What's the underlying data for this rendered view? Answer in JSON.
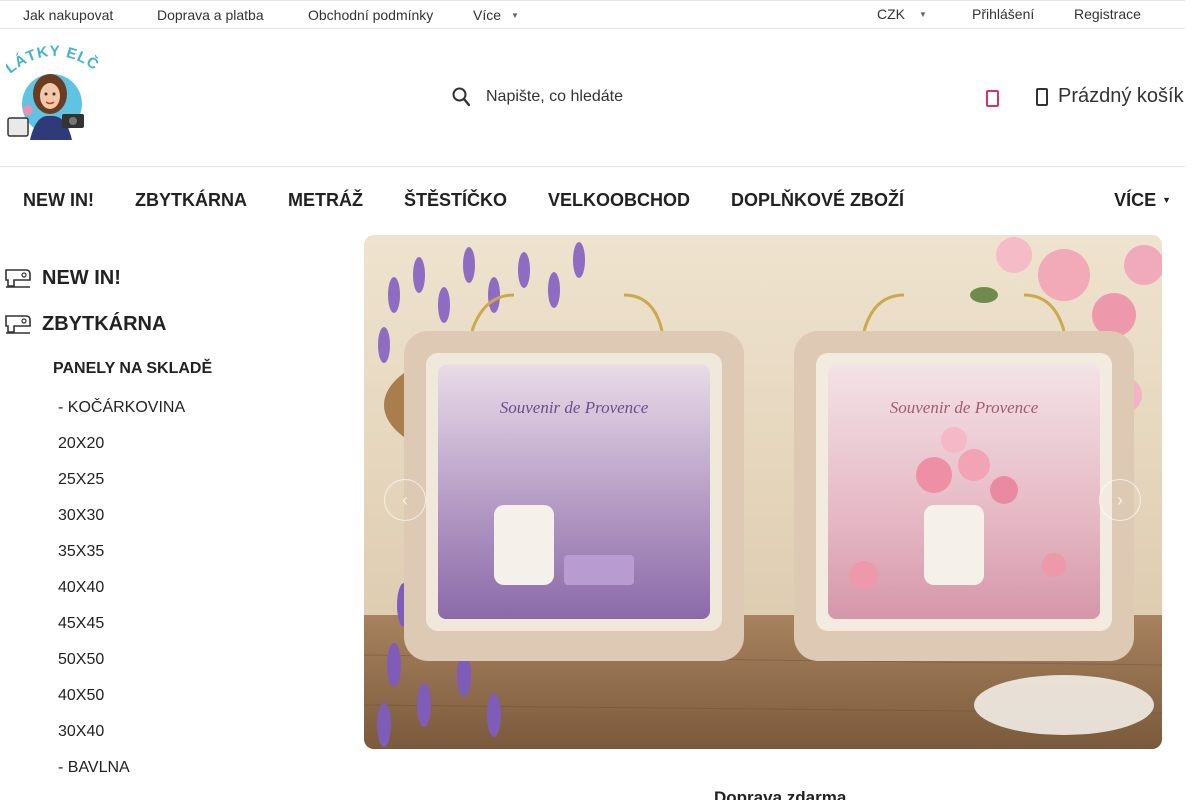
{
  "topbar": {
    "links": [
      "Jak nakupovat",
      "Doprava a platba",
      "Obchodní podmínky",
      "Více"
    ],
    "currency": "CZK",
    "login": "Přihlášení",
    "register": "Registrace"
  },
  "logo": {
    "text": "LÁTKY ELČA"
  },
  "search": {
    "placeholder": "Napište, co hledáte"
  },
  "cart": {
    "label": "Prázdný košík"
  },
  "mainnav": {
    "items": [
      "NEW IN!",
      "ZBYTKÁRNA",
      "METRÁŽ",
      "ŠTĚSTÍČKO",
      "VELKOOBCHOD",
      "DOPLŇKOVÉ ZBOŽÍ"
    ],
    "more": "VÍCE"
  },
  "sidebar": {
    "categories": [
      "NEW IN!",
      "ZBYTKÁRNA"
    ],
    "subcategory": "PANELY NA SKLADĚ",
    "leaves": [
      "- KOČÁRKOVINA",
      "20X20",
      "25X25",
      "30X30",
      "35X35",
      "40X40",
      "45X45",
      "50X50",
      "40X50",
      "30X40",
      "- BAVLNA"
    ]
  },
  "banner": {
    "left_bag_text": "Souvenir de Provence",
    "right_bag_text": "Souvenir de Provence"
  },
  "below_banner": "Doprava zdarma",
  "colors": {
    "accent_pink": "#d6336c",
    "text": "#222222"
  }
}
